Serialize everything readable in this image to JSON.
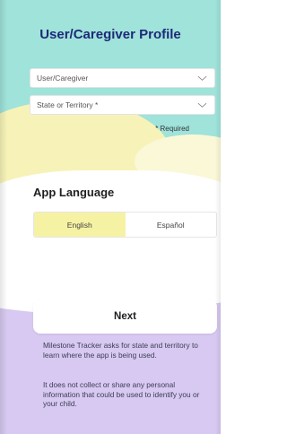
{
  "page": {
    "title": "User/Caregiver Profile"
  },
  "form": {
    "user_caregiver_placeholder": "User/Caregiver",
    "state_placeholder": "State or Territory *",
    "required_note": "* Required"
  },
  "language": {
    "heading": "App Language",
    "options": [
      "English",
      "Español"
    ],
    "selected": "English"
  },
  "actions": {
    "next_label": "Next"
  },
  "info": {
    "paragraph1": "Milestone Tracker asks for state and territory to learn where the app is being used.",
    "paragraph2": "It does not collect or share any personal information that could be used to identify you or your child."
  },
  "colors": {
    "title": "#1e2a78",
    "teal": "#9fe3da",
    "yellow": "#f7f3b8",
    "lavender": "#d7c9f1",
    "selected_language": "#f6f2a4"
  },
  "icons": {
    "dropdown": "chevron-down-icon"
  }
}
